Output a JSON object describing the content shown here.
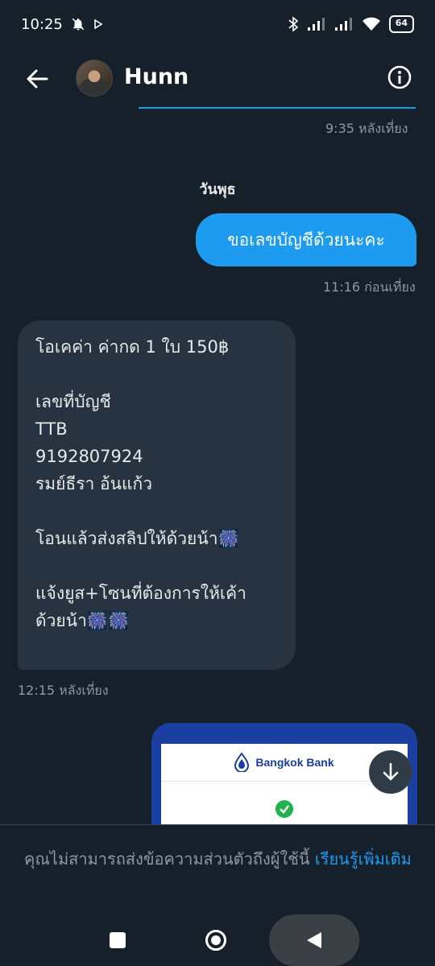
{
  "status_bar": {
    "time": "10:25",
    "battery": "64"
  },
  "header": {
    "title": "Hunn"
  },
  "messages": {
    "prev_time": "9:35 หลังเที่ยง",
    "day": "วันพุธ",
    "outgoing": {
      "text": "ขอเลขบัญชีด้วยนะคะ",
      "time": "11:16 ก่อนเที่ยง"
    },
    "incoming": {
      "lines": [
        "โอเคค่า ค่ากด 1 ใบ 150฿",
        "",
        "เลขที่บัญชี",
        "TTB",
        "9192807924",
        "รมย์ธีรา อ้นแก้ว",
        "",
        "โอนแล้วส่งสลิปให้ด้วยน้า🎆",
        "",
        "แจ้งยูส+โซนที่ต้องการให้เค้า",
        "ด้วยน้า🎆🎆"
      ],
      "time": "12:15 หลังเที่ยง"
    },
    "image": {
      "bank_name": "Bangkok Bank"
    }
  },
  "footer": {
    "notice": "คุณไม่สามารถส่งข้อความส่วนตัวถึงผู้ใช้นี้",
    "link": "เรียนรู้เพิ่มเติม"
  },
  "colors": {
    "accent": "#1d9bf0",
    "background": "#15202b",
    "bubble_in": "#273340"
  }
}
